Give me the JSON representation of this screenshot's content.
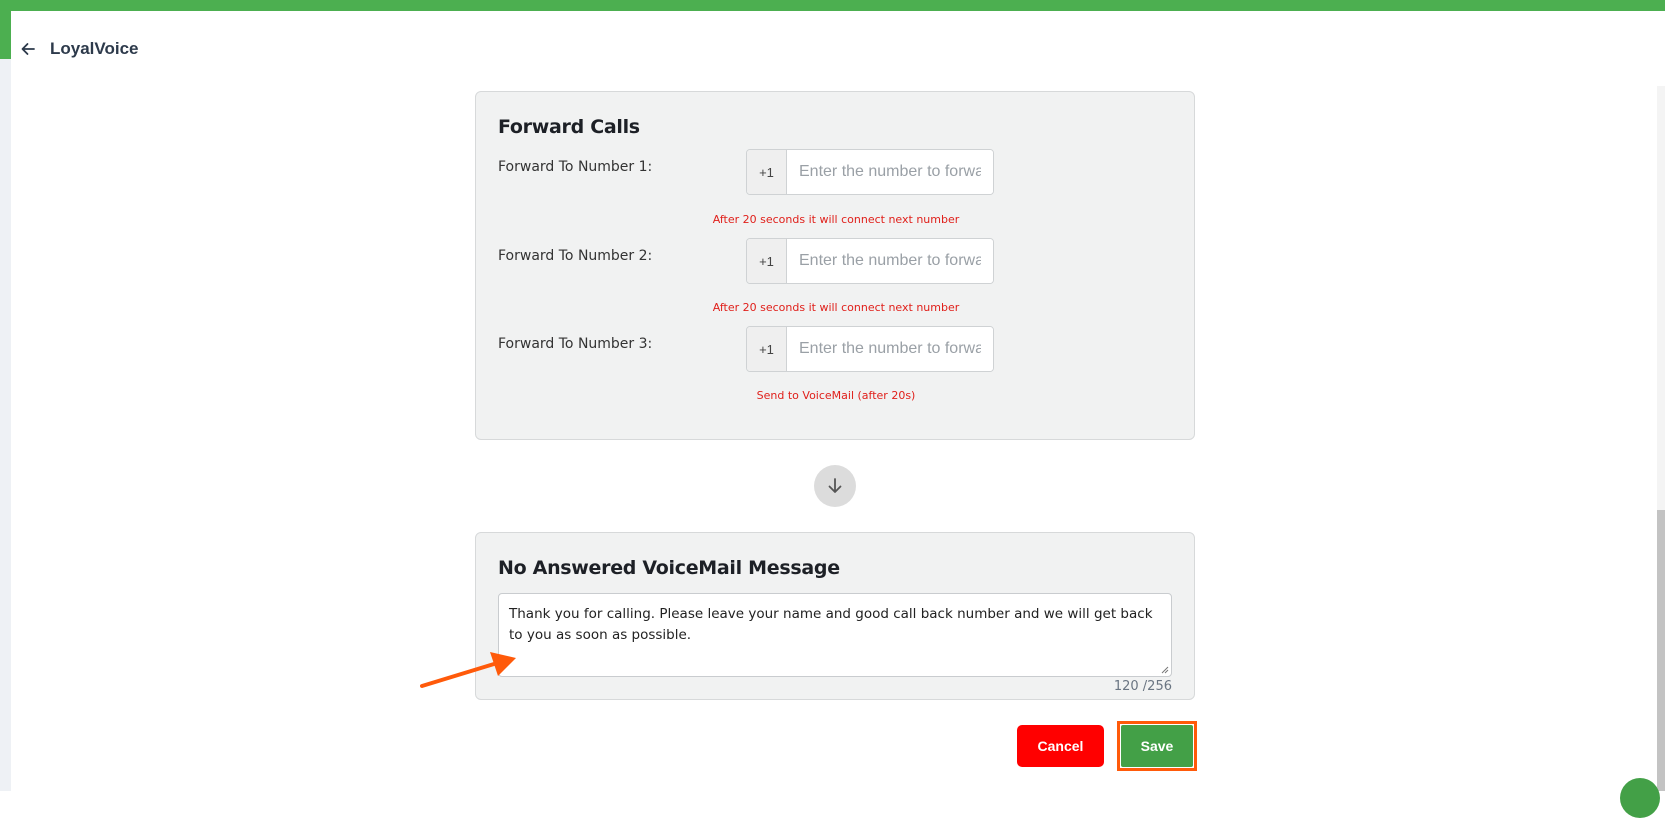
{
  "header": {
    "back_icon": "arrow-left-icon",
    "title": "LoyalVoice"
  },
  "forward_calls": {
    "title": "Forward Calls",
    "rows": [
      {
        "label": "Forward To Number 1:",
        "prefix": "+1",
        "value": "",
        "placeholder": "Enter the number to forward",
        "hint": "After 20 seconds it will connect next number"
      },
      {
        "label": "Forward To Number 2:",
        "prefix": "+1",
        "value": "",
        "placeholder": "Enter the number to forward",
        "hint": "After 20 seconds it will connect next number"
      },
      {
        "label": "Forward To Number 3:",
        "prefix": "+1",
        "value": "",
        "placeholder": "Enter the number to forward",
        "hint": "Send to VoiceMail (after 20s)"
      }
    ]
  },
  "flow_icon": "arrow-down-icon",
  "voicemail": {
    "title": "No Answered VoiceMail Message",
    "message": "Thank you for calling. Please leave your name and good call back number and we will get back to you as soon as possible.",
    "counter": "120 /256"
  },
  "actions": {
    "cancel_label": "Cancel",
    "save_label": "Save"
  },
  "colors": {
    "brand_green": "#4caf50",
    "save_green": "#43a047",
    "cancel_red": "#ff0000",
    "hint_red": "#e0201b",
    "annotation_orange": "#ff5a0a"
  }
}
